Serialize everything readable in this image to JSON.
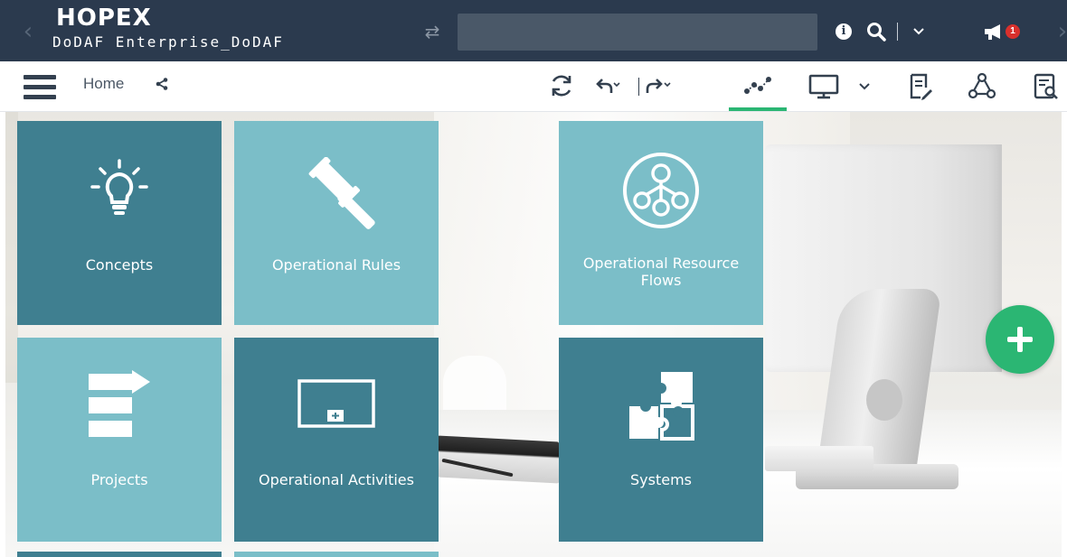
{
  "topbar": {
    "logo": "HOPEX",
    "environment": "DoDAF Enterprise_DoDAF",
    "search_placeholder": "",
    "info_label": "i",
    "notification_count": "1",
    "nav_prev": "‹",
    "nav_next": "›",
    "swap": "⇄"
  },
  "toolbar": {
    "breadcrumb_home": "Home"
  },
  "tiles": [
    {
      "label": "Concepts",
      "icon": "lightbulb-icon",
      "style": "dark"
    },
    {
      "label": "Operational Rules",
      "icon": "gavel-icon",
      "style": "light"
    },
    {
      "label": "Operational Resource Flows",
      "icon": "flow-network-icon",
      "style": "light"
    },
    {
      "label": "Projects",
      "icon": "project-list-icon",
      "style": "light"
    },
    {
      "label": "Operational Activities",
      "icon": "activity-board-icon",
      "style": "dark"
    },
    {
      "label": "Systems",
      "icon": "puzzle-icon",
      "style": "dark"
    }
  ],
  "colors": {
    "topbar": "#2b3a4e",
    "tile_dark": "#3f7f90",
    "tile_light": "#7bbec8",
    "accent_green": "#2bb673",
    "badge_red": "#d9302c"
  }
}
